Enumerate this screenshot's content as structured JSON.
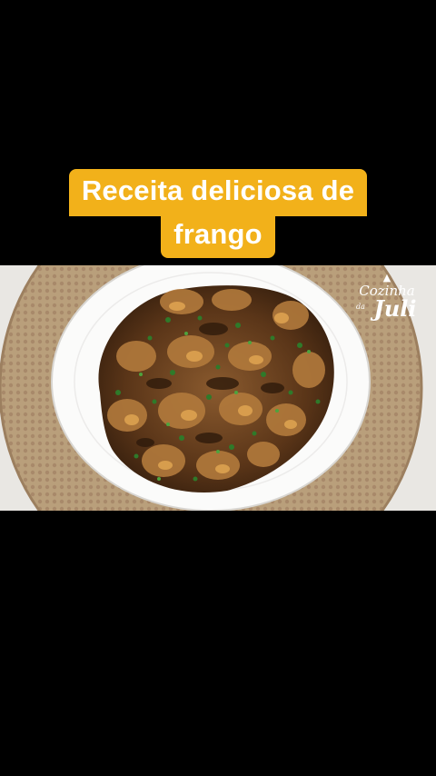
{
  "caption": {
    "line1": "Receita deliciosa de",
    "line2": "frango"
  },
  "watermark": {
    "icon": "chef-hat-icon",
    "line1": "Cozinha",
    "line2": "da",
    "line3": "Juli"
  },
  "colors": {
    "caption_bg": "#f2b11a",
    "caption_text": "#ffffff",
    "background": "#000000"
  }
}
